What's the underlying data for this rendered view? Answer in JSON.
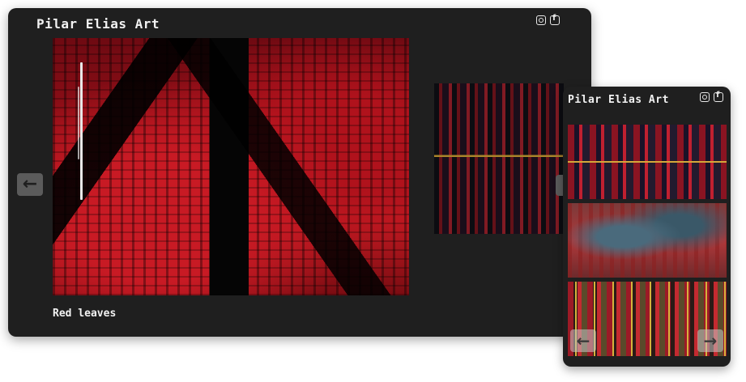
{
  "site": {
    "title": "Pilar Elias Art"
  },
  "social": {
    "icons": [
      "instagram-icon",
      "facebook-icon"
    ]
  },
  "gallery": {
    "current_caption": "Red leaves",
    "prev_arrow": "←",
    "next_arrow": "→"
  },
  "colors": {
    "background": "#1f1f1f",
    "text": "#f2f2f2",
    "nav_button": "#5b5b5b"
  }
}
